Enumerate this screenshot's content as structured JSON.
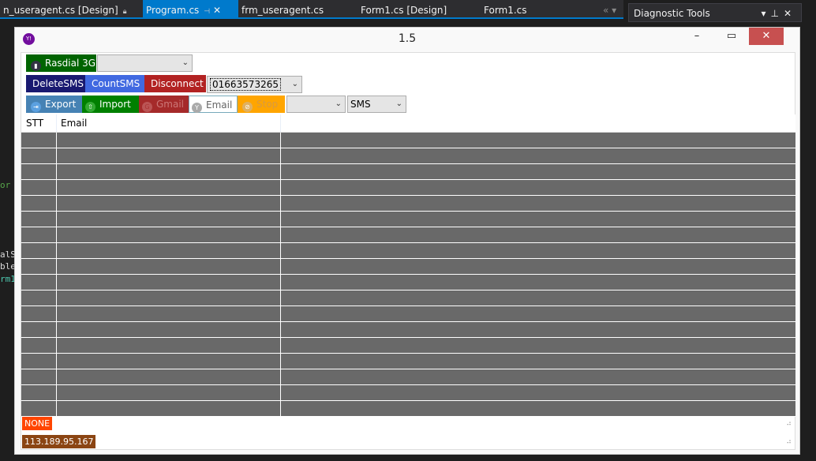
{
  "ide": {
    "tabs": [
      {
        "label": "n_useragent.cs [Design]"
      },
      {
        "label": "Program.cs"
      },
      {
        "label": "frm_useragent.cs"
      },
      {
        "label": "Form1.cs [Design]"
      },
      {
        "label": "Form1.cs"
      }
    ],
    "diagnostic_title": "Diagnostic Tools",
    "code_fragments": [
      "or",
      "alS",
      "ble",
      "rm1"
    ]
  },
  "window": {
    "title": "1.5"
  },
  "toolbar": {
    "rasdial_label": "Rasdial 3G",
    "rasdial_combo": "",
    "delete_sms": "DeleteSMS",
    "count_sms": "CountSMS",
    "disconnect": "Disconnect",
    "phone_combo": "01663573265",
    "export": "Export",
    "import": "Import",
    "gmail": "Gmail",
    "email": "Email",
    "stop": "Stop",
    "mode_combo": "",
    "type_combo": "SMS"
  },
  "grid": {
    "columns": [
      "STT",
      "Email"
    ],
    "row_count": 18
  },
  "status": {
    "state": "NONE",
    "ip": "113.189.95.167"
  }
}
